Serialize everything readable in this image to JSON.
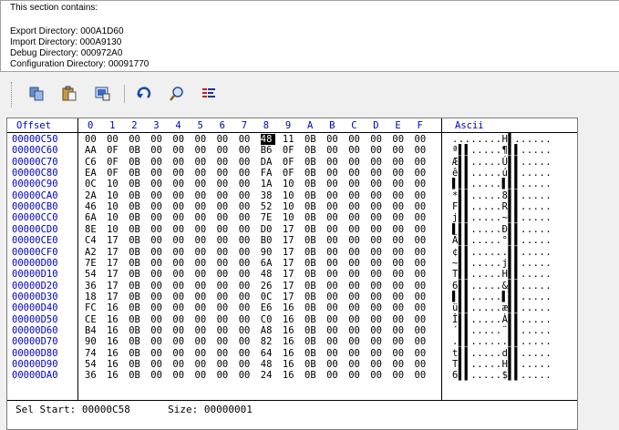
{
  "info": {
    "heading": "This section contains:",
    "lines": [
      "Export Directory: 000A1D60",
      "Import Directory: 000A9130",
      "Debug Directory: 000972A0",
      "Configuration Directory: 00091770"
    ]
  },
  "toolbar": {
    "buttons": [
      {
        "name": "copy-button",
        "icon": "copy-icon"
      },
      {
        "name": "paste-button",
        "icon": "paste-icon"
      },
      {
        "name": "properties-button",
        "icon": "properties-icon"
      },
      {
        "name": "goto-button",
        "icon": "goto-arrow-icon"
      },
      {
        "name": "find-button",
        "icon": "search-icon"
      },
      {
        "name": "disasm-button",
        "icon": "disassembly-icon"
      }
    ]
  },
  "hex": {
    "offset_header": "Offset",
    "columns": [
      "0",
      "1",
      "2",
      "3",
      "4",
      "5",
      "6",
      "7",
      "8",
      "9",
      "A",
      "B",
      "C",
      "D",
      "E",
      "F"
    ],
    "ascii_header": "Ascii",
    "selected": {
      "row": 0,
      "col": 8
    },
    "rows": [
      {
        "offset": "00000C50",
        "bytes": [
          "00",
          "00",
          "00",
          "00",
          "00",
          "00",
          "00",
          "00",
          "48",
          "11",
          "0B",
          "00",
          "00",
          "00",
          "00",
          "00"
        ],
        "ascii": "........H▌......"
      },
      {
        "offset": "00000C60",
        "bytes": [
          "AA",
          "0F",
          "0B",
          "00",
          "00",
          "00",
          "00",
          "00",
          "B6",
          "0F",
          "0B",
          "00",
          "00",
          "00",
          "00",
          "00"
        ],
        "ascii": "ª▌▌.....¶▌▌....."
      },
      {
        "offset": "00000C70",
        "bytes": [
          "C6",
          "0F",
          "0B",
          "00",
          "00",
          "00",
          "00",
          "00",
          "DA",
          "0F",
          "0B",
          "00",
          "00",
          "00",
          "00",
          "00"
        ],
        "ascii": "Æ▌▌.....Ú▌▌....."
      },
      {
        "offset": "00000C80",
        "bytes": [
          "EA",
          "0F",
          "0B",
          "00",
          "00",
          "00",
          "00",
          "00",
          "FA",
          "0F",
          "0B",
          "00",
          "00",
          "00",
          "00",
          "00"
        ],
        "ascii": "ê▌▌.....ú▌▌....."
      },
      {
        "offset": "00000C90",
        "bytes": [
          "0C",
          "10",
          "0B",
          "00",
          "00",
          "00",
          "00",
          "00",
          "1A",
          "10",
          "0B",
          "00",
          "00",
          "00",
          "00",
          "00"
        ],
        "ascii": "▌▌▌.....▌▌▌....."
      },
      {
        "offset": "00000CA0",
        "bytes": [
          "2A",
          "10",
          "0B",
          "00",
          "00",
          "00",
          "00",
          "00",
          "38",
          "10",
          "0B",
          "00",
          "00",
          "00",
          "00",
          "00"
        ],
        "ascii": "*▌▌.....8▌▌....."
      },
      {
        "offset": "00000CB0",
        "bytes": [
          "46",
          "10",
          "0B",
          "00",
          "00",
          "00",
          "00",
          "00",
          "52",
          "10",
          "0B",
          "00",
          "00",
          "00",
          "00",
          "00"
        ],
        "ascii": "F▌▌.....R▌▌....."
      },
      {
        "offset": "00000CC0",
        "bytes": [
          "6A",
          "10",
          "0B",
          "00",
          "00",
          "00",
          "00",
          "00",
          "7E",
          "10",
          "0B",
          "00",
          "00",
          "00",
          "00",
          "00"
        ],
        "ascii": "j▌▌.....~▌▌....."
      },
      {
        "offset": "00000CD0",
        "bytes": [
          "8E",
          "10",
          "0B",
          "00",
          "00",
          "00",
          "00",
          "00",
          "D0",
          "17",
          "0B",
          "00",
          "00",
          "00",
          "00",
          "00"
        ],
        "ascii": "▌▌▌.....Ð▌▌....."
      },
      {
        "offset": "00000CE0",
        "bytes": [
          "C4",
          "17",
          "0B",
          "00",
          "00",
          "00",
          "00",
          "00",
          "B0",
          "17",
          "0B",
          "00",
          "00",
          "00",
          "00",
          "00"
        ],
        "ascii": "Ä▌▌.....°▌▌....."
      },
      {
        "offset": "00000CF0",
        "bytes": [
          "A2",
          "17",
          "0B",
          "00",
          "00",
          "00",
          "00",
          "00",
          "90",
          "17",
          "0B",
          "00",
          "00",
          "00",
          "00",
          "00"
        ],
        "ascii": "¢▌▌......▌▌....."
      },
      {
        "offset": "00000D00",
        "bytes": [
          "7E",
          "17",
          "0B",
          "00",
          "00",
          "00",
          "00",
          "00",
          "6A",
          "17",
          "0B",
          "00",
          "00",
          "00",
          "00",
          "00"
        ],
        "ascii": "~▌▌.....j▌▌....."
      },
      {
        "offset": "00000D10",
        "bytes": [
          "54",
          "17",
          "0B",
          "00",
          "00",
          "00",
          "00",
          "00",
          "48",
          "17",
          "0B",
          "00",
          "00",
          "00",
          "00",
          "00"
        ],
        "ascii": "T▌▌.....H▌▌....."
      },
      {
        "offset": "00000D20",
        "bytes": [
          "36",
          "17",
          "0B",
          "00",
          "00",
          "00",
          "00",
          "00",
          "26",
          "17",
          "0B",
          "00",
          "00",
          "00",
          "00",
          "00"
        ],
        "ascii": "6▌▌.....&▌▌....."
      },
      {
        "offset": "00000D30",
        "bytes": [
          "18",
          "17",
          "0B",
          "00",
          "00",
          "00",
          "00",
          "00",
          "0C",
          "17",
          "0B",
          "00",
          "00",
          "00",
          "00",
          "00"
        ],
        "ascii": "▌▌▌.....▌▌▌....."
      },
      {
        "offset": "00000D40",
        "bytes": [
          "FC",
          "16",
          "0B",
          "00",
          "00",
          "00",
          "00",
          "00",
          "E6",
          "16",
          "0B",
          "00",
          "00",
          "00",
          "00",
          "00"
        ],
        "ascii": "ü▌▌.....æ▌▌....."
      },
      {
        "offset": "00000D50",
        "bytes": [
          "CE",
          "16",
          "0B",
          "00",
          "00",
          "00",
          "00",
          "00",
          "C0",
          "16",
          "0B",
          "00",
          "00",
          "00",
          "00",
          "00"
        ],
        "ascii": "Î▌▌.....À▌▌....."
      },
      {
        "offset": "00000D60",
        "bytes": [
          "B4",
          "16",
          "0B",
          "00",
          "00",
          "00",
          "00",
          "00",
          "A8",
          "16",
          "0B",
          "00",
          "00",
          "00",
          "00",
          "00"
        ],
        "ascii": "´▌▌.....¨▌▌....."
      },
      {
        "offset": "00000D70",
        "bytes": [
          "90",
          "16",
          "0B",
          "00",
          "00",
          "00",
          "00",
          "00",
          "82",
          "16",
          "0B",
          "00",
          "00",
          "00",
          "00",
          "00"
        ],
        "ascii": ".▌▌......▌▌....."
      },
      {
        "offset": "00000D80",
        "bytes": [
          "74",
          "16",
          "0B",
          "00",
          "00",
          "00",
          "00",
          "00",
          "64",
          "16",
          "0B",
          "00",
          "00",
          "00",
          "00",
          "00"
        ],
        "ascii": "t▌▌.....d▌▌....."
      },
      {
        "offset": "00000D90",
        "bytes": [
          "54",
          "16",
          "0B",
          "00",
          "00",
          "00",
          "00",
          "00",
          "48",
          "16",
          "0B",
          "00",
          "00",
          "00",
          "00",
          "00"
        ],
        "ascii": "T▌▌.....H▌▌....."
      },
      {
        "offset": "00000DA0",
        "bytes": [
          "36",
          "16",
          "0B",
          "00",
          "00",
          "00",
          "00",
          "00",
          "24",
          "16",
          "0B",
          "00",
          "00",
          "00",
          "00",
          "00"
        ],
        "ascii": "6▌▌.....$▌▌....."
      }
    ]
  },
  "status": {
    "sel_start_label": "Sel Start:",
    "sel_start_value": "00000C58",
    "size_label": "Size:",
    "size_value": "00000001"
  },
  "colors": {
    "header_blue": "#0000c8",
    "selection": "#000000"
  }
}
